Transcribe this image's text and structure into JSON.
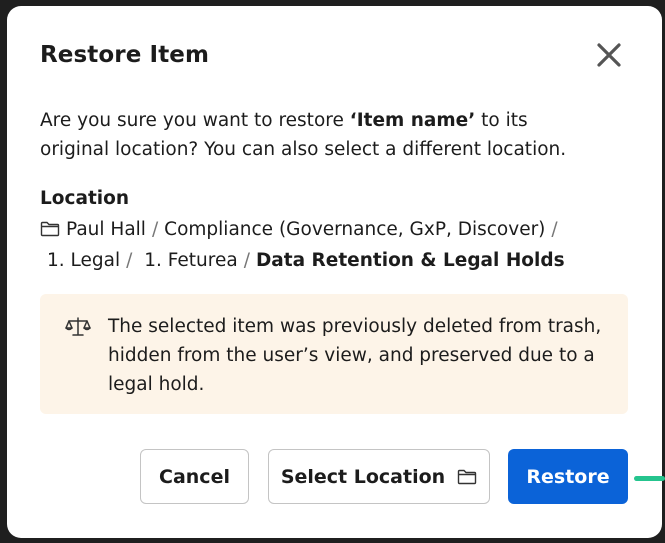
{
  "dialog": {
    "title": "Restore Item",
    "close_icon": "close-icon",
    "message_before": "Are you sure you want to restore ",
    "item_name": "‘Item name’",
    "message_after": " to its original location? You can also select a different location.",
    "location_label": "Location",
    "location_path": [
      {
        "label": "Paul Hall",
        "icon": "folder-icon"
      },
      {
        "label": "Compliance (Governance, GxP, Discover)"
      },
      {
        "label": "1. Legal"
      },
      {
        "label": "1. Feturea"
      },
      {
        "label": "Data Retention & Legal Holds",
        "current": true
      }
    ],
    "notice": {
      "icon": "scale-icon",
      "text": "The selected item was previously deleted from trash, hidden from the user’s view, and preserved due to a legal hold."
    },
    "buttons": {
      "cancel": "Cancel",
      "select_location": "Select Location",
      "restore": "Restore"
    }
  },
  "colors": {
    "primary": "#0b63d8",
    "notice_bg": "#fdf4e8",
    "connector": "#25c48e"
  }
}
